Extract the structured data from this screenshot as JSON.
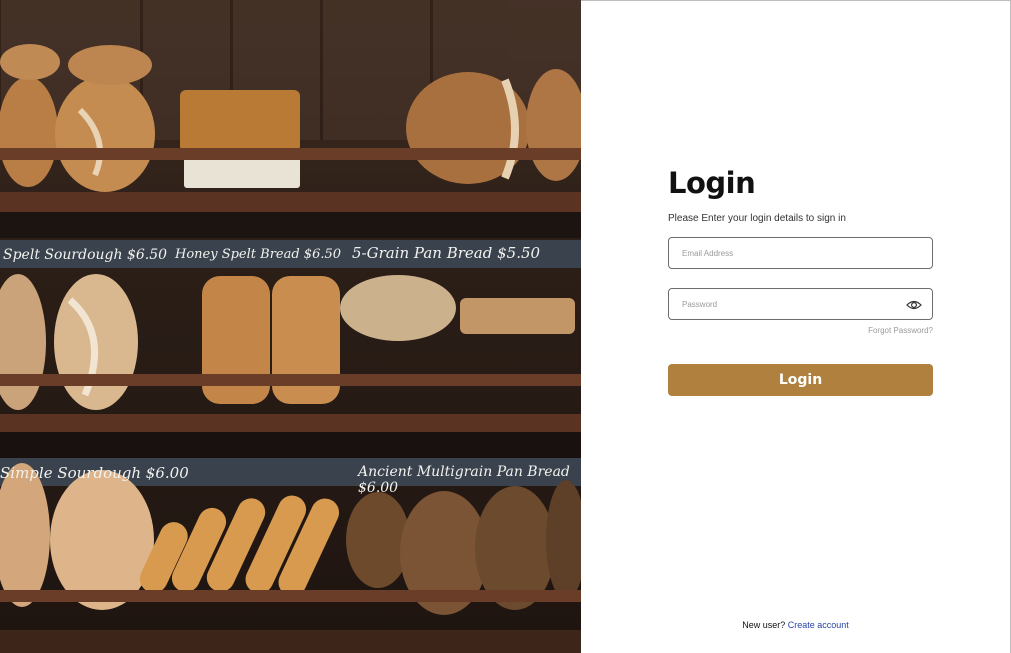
{
  "hero": {
    "image_subject": "bakery-bread-shelves",
    "chalk_labels": [
      "Spelt Sourdough $6.50",
      "Honey Spelt Bread $6.50",
      "5-Grain Pan Bread $5.50",
      "Simple Sourdough $6.00",
      "Ancient Multigrain Pan Bread $6.00"
    ]
  },
  "login": {
    "title": "Login",
    "subtitle": "Please Enter your login details to sign in",
    "email_placeholder": "Email Address",
    "password_placeholder": "Password",
    "forgot_label": "Forgot Password?",
    "button_label": "Login"
  },
  "footer": {
    "prompt": "New user?",
    "link_label": "Create account"
  },
  "colors": {
    "accent": "#b0803f",
    "link": "#2a45a8",
    "chalkboard": "#39424d",
    "shelf": "#6a3d28"
  }
}
